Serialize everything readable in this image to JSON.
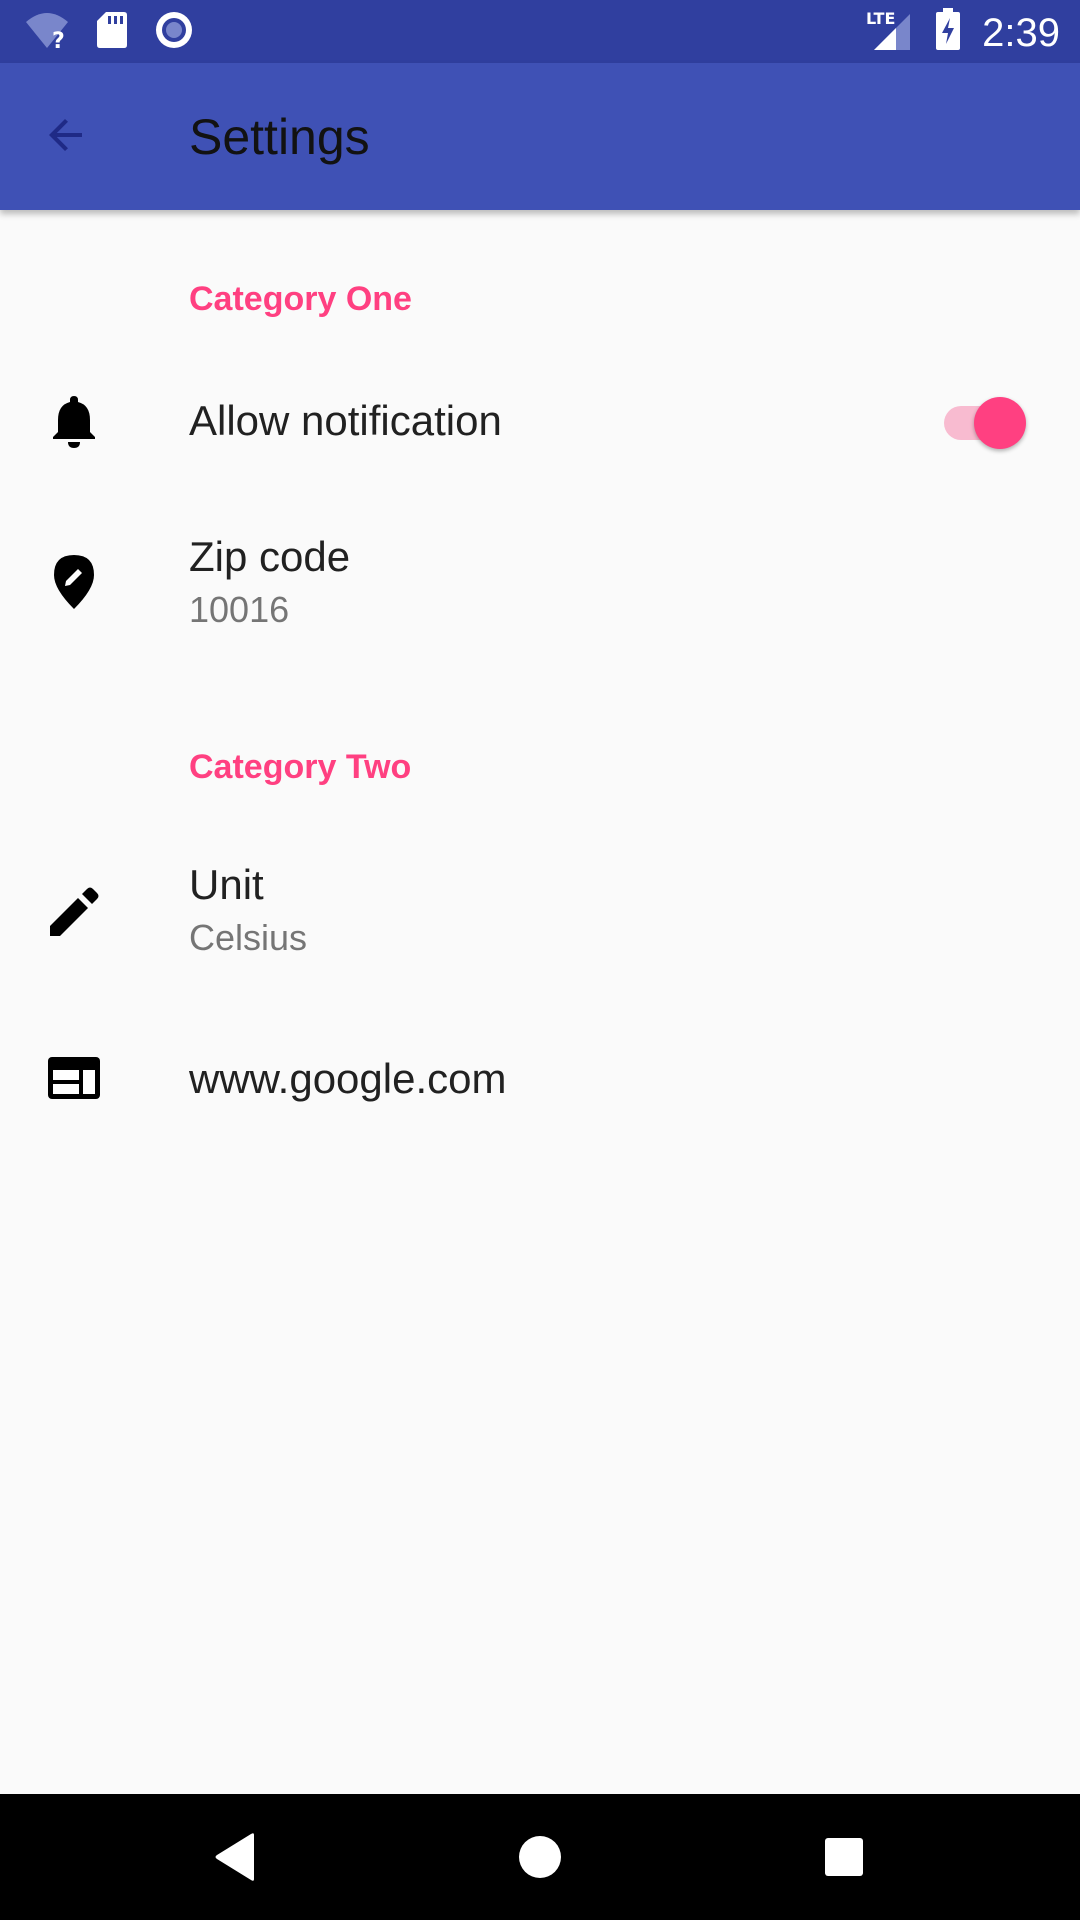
{
  "status_bar": {
    "time": "2:39",
    "network_label": "LTE",
    "icons": [
      "wifi-unknown-icon",
      "sd-card-icon",
      "sync-circle-icon",
      "cell-signal-icon",
      "battery-charging-icon"
    ],
    "background": "#303f9f"
  },
  "app_bar": {
    "title": "Settings",
    "back_icon": "arrow-back-icon",
    "background": "#3f51b5"
  },
  "categories": [
    {
      "title": "Category One",
      "items": [
        {
          "icon": "bell-icon",
          "title": "Allow notification",
          "switch_on": true
        },
        {
          "icon": "location-edit-icon",
          "title": "Zip code",
          "summary": "10016"
        }
      ]
    },
    {
      "title": "Category Two",
      "items": [
        {
          "icon": "pencil-icon",
          "title": "Unit",
          "summary": "Celsius"
        },
        {
          "icon": "web-icon",
          "title": "www.google.com"
        }
      ]
    }
  ],
  "nav_bar": {
    "buttons": [
      "back-triangle-icon",
      "home-circle-icon",
      "recents-square-icon"
    ]
  },
  "colors": {
    "accent": "#ff4081",
    "primary": "#3f51b5",
    "primary_dark": "#303f9f"
  }
}
